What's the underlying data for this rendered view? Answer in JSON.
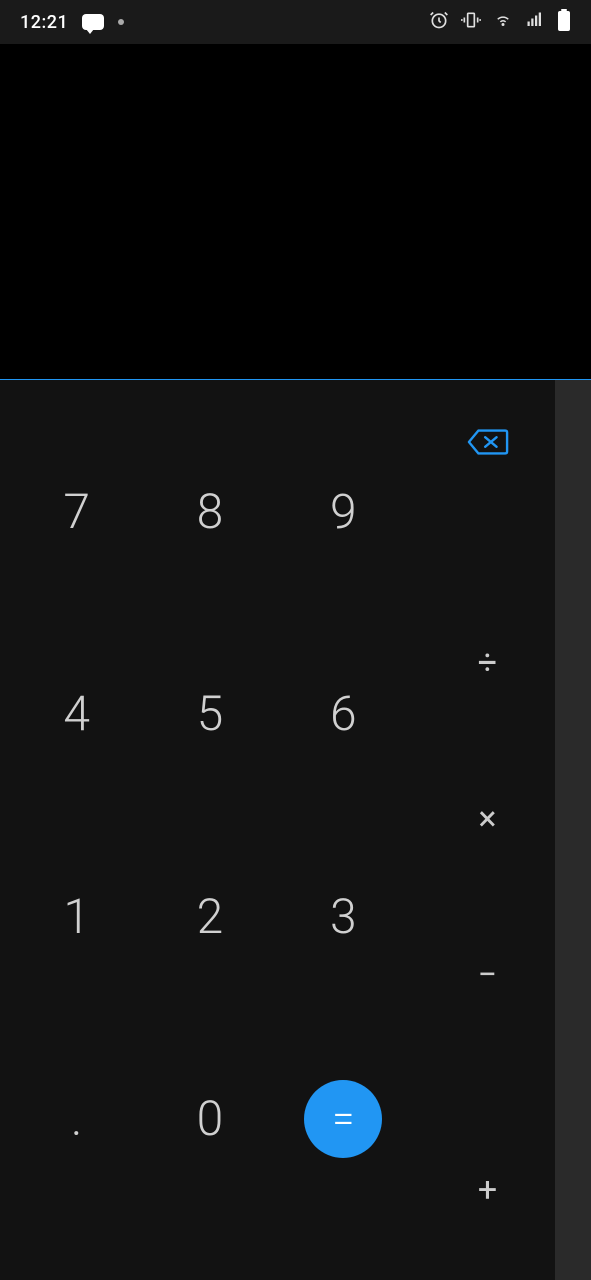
{
  "status": {
    "time": "12:21"
  },
  "keypad": {
    "r0c0": "7",
    "r0c1": "8",
    "r0c2": "9",
    "r1c0": "4",
    "r1c1": "5",
    "r1c2": "6",
    "r2c0": "1",
    "r2c1": "2",
    "r2c2": "3",
    "r3c0": ".",
    "r3c1": "0"
  },
  "ops": {
    "divide": "÷",
    "multiply": "×",
    "minus": "−",
    "plus": "+",
    "equals": "="
  },
  "colors": {
    "accent": "#2196f3"
  }
}
